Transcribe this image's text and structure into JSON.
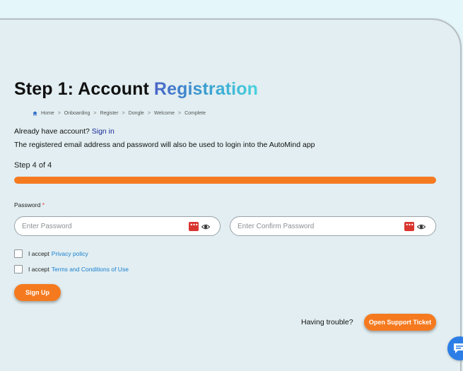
{
  "header": {
    "title_prefix": "Step 1: Account",
    "title_accent": "Registration"
  },
  "breadcrumb": {
    "items": [
      "Home",
      "Onboarding",
      "Register",
      "Dongle",
      "Welcome",
      "Complete"
    ],
    "separator": ">"
  },
  "account": {
    "prompt": "Already have account?",
    "signin_link": "Sign in"
  },
  "info_text": "The registered email address and password will also be used to login into the AutoMind app",
  "progress": {
    "step_label": "Step 4 of 4",
    "fraction": 1.0,
    "color": "#f57a1f"
  },
  "form": {
    "password_label": "Password",
    "required_marker": "*",
    "password_placeholder": "Enter Password",
    "confirm_placeholder": "Enter Confirm Password",
    "password_manager_icon": "password-manager-icon",
    "reveal_icon": "eye-icon"
  },
  "consents": {
    "privacy_prefix": "I accept",
    "privacy_link": "Privacy policy",
    "terms_prefix": "I accept",
    "terms_link": "Terms and Conditions of Use"
  },
  "buttons": {
    "signup": "Sign Up",
    "support": "Open Support Ticket"
  },
  "support": {
    "trouble_text": "Having trouble?"
  },
  "colors": {
    "accent": "#f57a1f",
    "link": "#1a7fd0",
    "signin_link": "#1c2a9a",
    "chat": "#2c7ee6"
  }
}
